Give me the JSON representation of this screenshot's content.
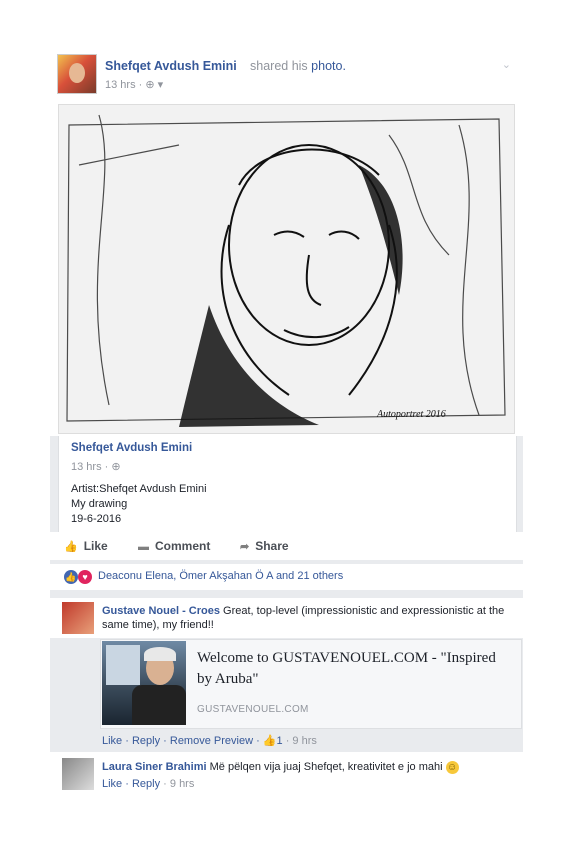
{
  "post": {
    "author": "Shefqet Avdush Emini",
    "shared_text": "shared his",
    "shared_link": "photo.",
    "time": "13 hrs",
    "privacy_glyph": "· ⊕ ▾",
    "menu_glyph": "⌄"
  },
  "shared_photo": {
    "author": "Shefqet Avdush Emini",
    "time": "13 hrs",
    "privacy_glyph": "· ⊕",
    "lines": [
      "Artist:Shefqet Avdush Emini",
      "My drawing",
      "19-6-2016"
    ],
    "signature": "Autoportret 2016"
  },
  "actions": {
    "like": "Like",
    "comment": "Comment",
    "share": "Share"
  },
  "reactions": {
    "text": "Deaconu Elena, Ömer Akşahan Ö A and 21 others",
    "like_color": "#4267b2",
    "love_color": "#e0245e"
  },
  "comments": [
    {
      "author": "Gustave Nouel - Croes",
      "text": "Great, top-level (impressionistic and expressionistic at the same time), my friend!!",
      "preview_title": "Welcome to GUSTAVENOUEL.COM - \"Inspired by Aruba\"",
      "preview_domain": "GUSTAVENOUEL.COM",
      "like": "Like",
      "reply": "Reply",
      "remove_preview": "Remove Preview",
      "like_count": "1",
      "time": "9 hrs"
    },
    {
      "author": "Laura Siner Brahimi",
      "text": "Më pëlqen vija juaj Shefqet, kreativitet e jo mahi",
      "emoji": "☺",
      "like": "Like",
      "reply": "Reply",
      "time": "9 hrs"
    }
  ]
}
